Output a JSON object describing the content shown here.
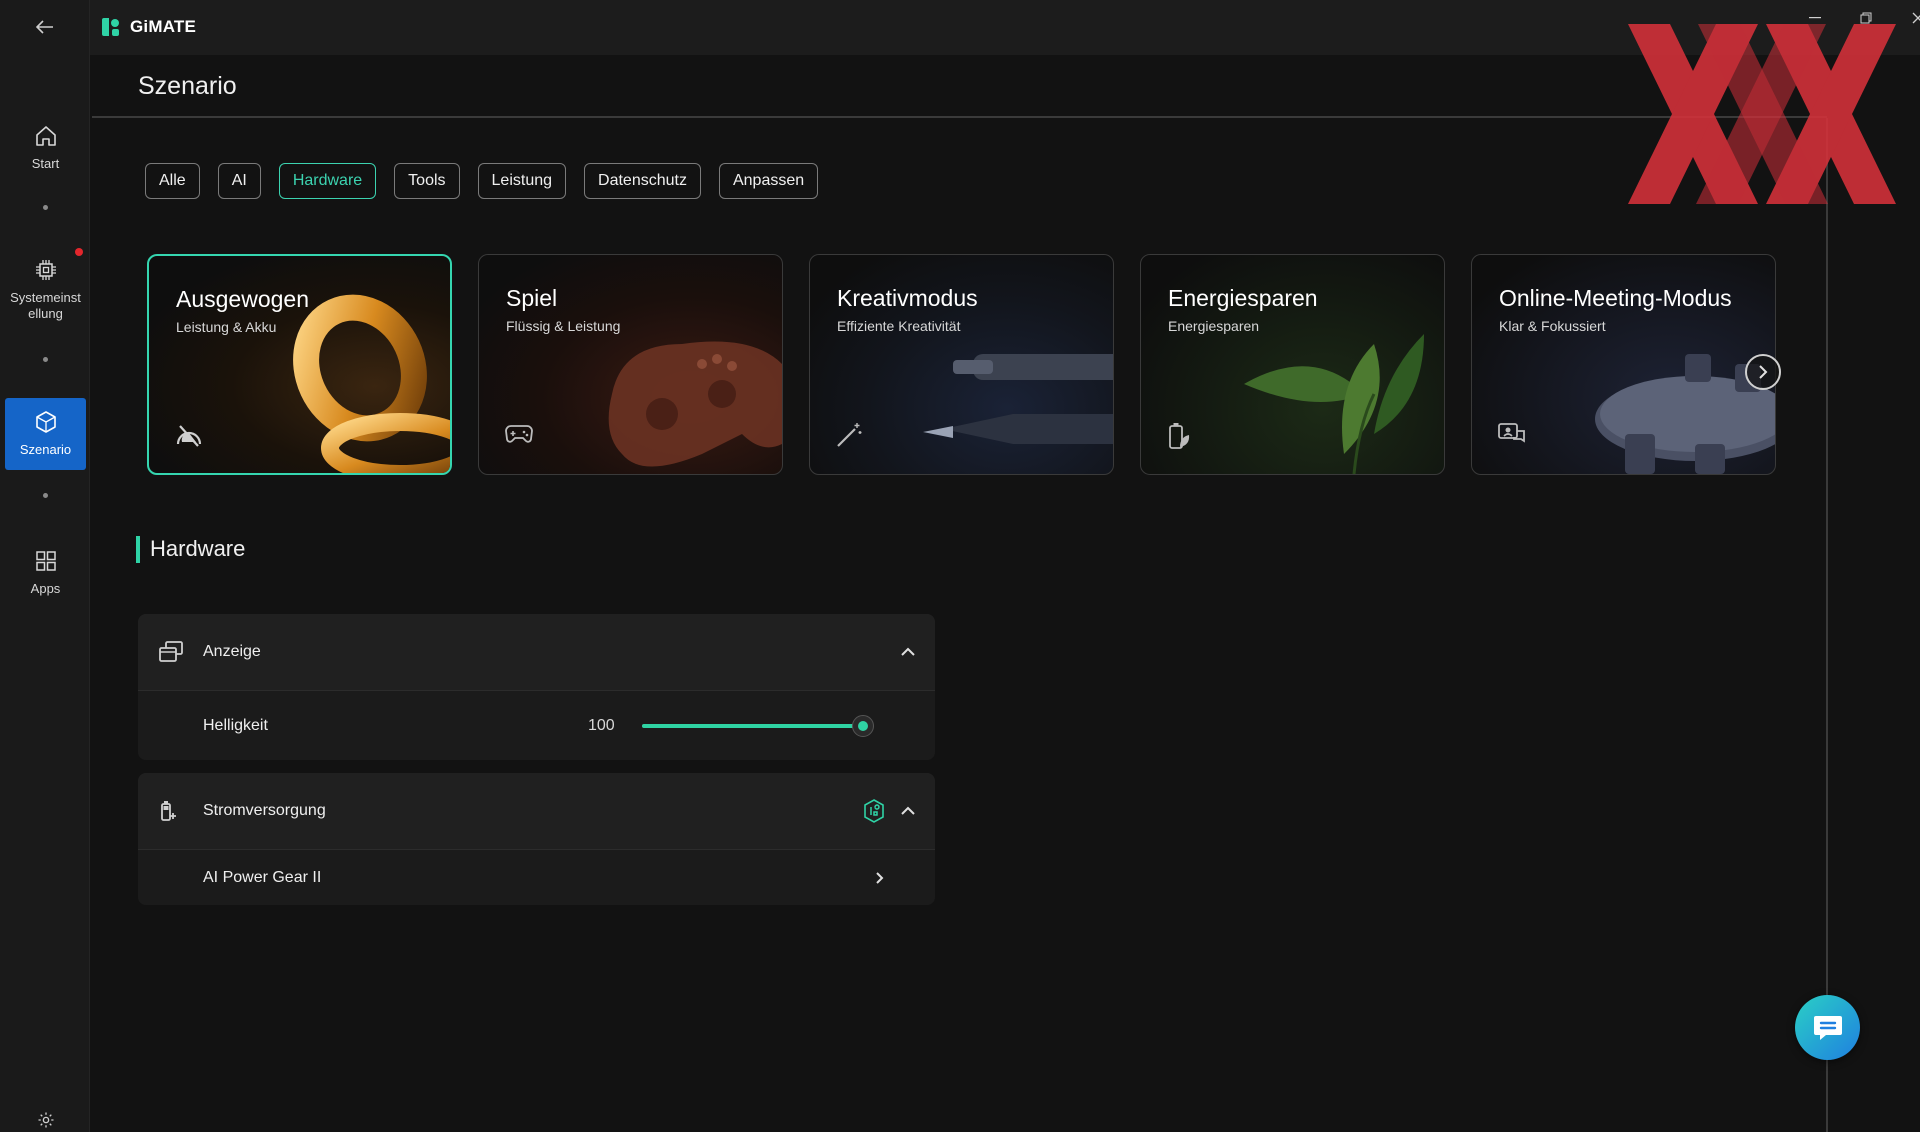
{
  "app": {
    "name": "GiMATE"
  },
  "sidebar": {
    "items": [
      {
        "label": "Start",
        "icon": "home-icon"
      },
      {
        "label": "Systemeinstellung",
        "label_line1": "Systemeinst",
        "label_line2": "ellung",
        "icon": "chip-icon",
        "notification": true
      },
      {
        "label": "Szenario",
        "icon": "cube-icon",
        "active": true
      },
      {
        "label": "Apps",
        "icon": "grid-icon"
      }
    ]
  },
  "page": {
    "title": "Szenario"
  },
  "filters": {
    "chips": [
      "Alle",
      "AI",
      "Hardware",
      "Tools",
      "Leistung",
      "Datenschutz",
      "Anpassen"
    ],
    "active": "Hardware"
  },
  "cards": [
    {
      "title": "Ausgewogen",
      "subtitle": "Leistung & Akku",
      "icon": "balance-icon",
      "active": true
    },
    {
      "title": "Spiel",
      "subtitle": "Flüssig & Leistung",
      "icon": "gamepad-icon"
    },
    {
      "title": "Kreativmodus",
      "subtitle": "Effiziente Kreativität",
      "icon": "magic-wand-icon"
    },
    {
      "title": "Energiesparen",
      "subtitle": "Energiesparen",
      "icon": "battery-leaf-icon"
    },
    {
      "title": "Online-Meeting-Modus",
      "subtitle": "Klar & Fokussiert",
      "icon": "meeting-icon"
    }
  ],
  "section": {
    "title": "Hardware"
  },
  "panels": {
    "display": {
      "label": "Anzeige",
      "brightness_label": "Helligkeit",
      "brightness_value": "100",
      "brightness_fraction": 1.0
    },
    "power": {
      "label": "Stromversorgung",
      "item_label": "AI Power Gear II"
    }
  },
  "colors": {
    "accent": "#2fd3a6",
    "active_nav": "#1565c8",
    "watermark": "#d6313a"
  }
}
